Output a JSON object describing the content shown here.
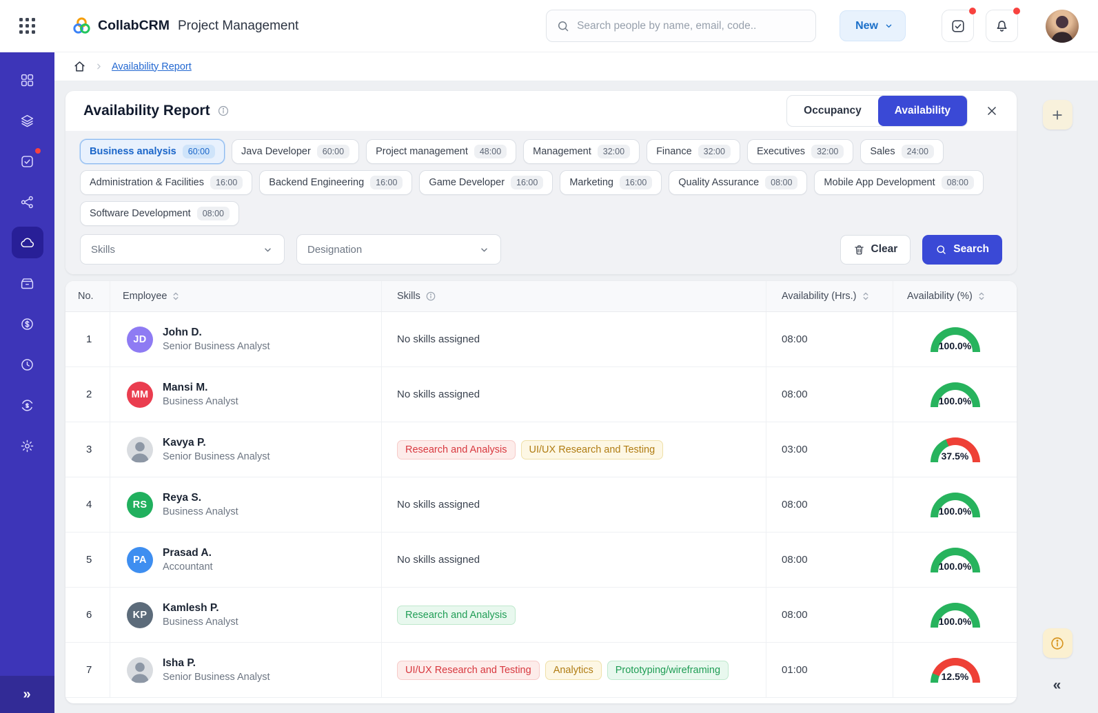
{
  "colors": {
    "sidebar": "#3d35b8",
    "accent_blue": "#3a49d6",
    "link_blue": "#2368d1",
    "chip_selected_blue": "#1b66c9",
    "gauge_green": "#27b35d",
    "gauge_red": "#ee4036",
    "notification_red": "#f8423f"
  },
  "header": {
    "brand": "CollabCRM",
    "product": "Project Management",
    "search_placeholder": "Search people by name, email, code..",
    "new_label": "New"
  },
  "sidebar": {
    "items": [
      {
        "icon": "dashboard",
        "active": false,
        "badge": false
      },
      {
        "icon": "layers",
        "active": false,
        "badge": false
      },
      {
        "icon": "tasks",
        "active": false,
        "badge": true
      },
      {
        "icon": "network",
        "active": false,
        "badge": false
      },
      {
        "icon": "cloud",
        "active": true,
        "badge": false
      },
      {
        "icon": "cashbox",
        "active": false,
        "badge": false
      },
      {
        "icon": "billing",
        "active": false,
        "badge": false
      },
      {
        "icon": "history",
        "active": false,
        "badge": false
      },
      {
        "icon": "exchange",
        "active": false,
        "badge": false
      },
      {
        "icon": "settings",
        "active": false,
        "badge": false
      }
    ],
    "expand_glyph": "»"
  },
  "breadcrumb": {
    "current": "Availability Report"
  },
  "report": {
    "title": "Availability Report",
    "toggles": {
      "occupancy": "Occupancy",
      "availability": "Availability"
    },
    "filters": [
      {
        "label": "Business analysis",
        "hours": "60:00",
        "selected": true
      },
      {
        "label": "Java Developer",
        "hours": "60:00",
        "selected": false
      },
      {
        "label": "Project management",
        "hours": "48:00",
        "selected": false
      },
      {
        "label": "Management",
        "hours": "32:00",
        "selected": false
      },
      {
        "label": "Finance",
        "hours": "32:00",
        "selected": false
      },
      {
        "label": "Executives",
        "hours": "32:00",
        "selected": false
      },
      {
        "label": "Sales",
        "hours": "24:00",
        "selected": false
      },
      {
        "label": "Administration & Facilities",
        "hours": "16:00",
        "selected": false
      },
      {
        "label": "Backend Engineering",
        "hours": "16:00",
        "selected": false
      },
      {
        "label": "Game Developer",
        "hours": "16:00",
        "selected": false
      },
      {
        "label": "Marketing",
        "hours": "16:00",
        "selected": false
      },
      {
        "label": "Quality Assurance",
        "hours": "08:00",
        "selected": false
      },
      {
        "label": "Mobile App Development",
        "hours": "08:00",
        "selected": false
      },
      {
        "label": "Software Development",
        "hours": "08:00",
        "selected": false
      }
    ],
    "skills_placeholder": "Skills",
    "designation_placeholder": "Designation",
    "clear_label": "Clear",
    "search_label": "Search"
  },
  "table": {
    "headers": {
      "no": "No.",
      "employee": "Employee",
      "skills": "Skills",
      "hours": "Availability (Hrs.)",
      "percent": "Availability (%)"
    },
    "empty_skills": "No skills assigned",
    "rows": [
      {
        "no": "1",
        "name": "John D.",
        "role": "Senior Business Analyst",
        "avatar": {
          "type": "initials",
          "text": "JD",
          "color": "#8e7bf3"
        },
        "skills": [],
        "hours": "08:00",
        "percent": 100,
        "percent_label": "100.0%"
      },
      {
        "no": "2",
        "name": "Mansi M.",
        "role": "Business Analyst",
        "avatar": {
          "type": "initials",
          "text": "MM",
          "color": "#ea3d4f"
        },
        "skills": [],
        "hours": "08:00",
        "percent": 100,
        "percent_label": "100.0%"
      },
      {
        "no": "3",
        "name": "Kavya P.",
        "role": "Senior Business Analyst",
        "avatar": {
          "type": "photo"
        },
        "skills": [
          {
            "label": "Research and Analysis",
            "variant": "red"
          },
          {
            "label": "UI/UX Research and Testing",
            "variant": "yellow"
          }
        ],
        "hours": "03:00",
        "percent": 37.5,
        "percent_label": "37.5%"
      },
      {
        "no": "4",
        "name": "Reya S.",
        "role": "Business Analyst",
        "avatar": {
          "type": "initials",
          "text": "RS",
          "color": "#21b05e"
        },
        "skills": [],
        "hours": "08:00",
        "percent": 100,
        "percent_label": "100.0%"
      },
      {
        "no": "5",
        "name": "Prasad A.",
        "role": "Accountant",
        "avatar": {
          "type": "initials",
          "text": "PA",
          "color": "#3e8ef0"
        },
        "skills": [],
        "hours": "08:00",
        "percent": 100,
        "percent_label": "100.0%"
      },
      {
        "no": "6",
        "name": "Kamlesh P.",
        "role": "Business Analyst",
        "avatar": {
          "type": "initials",
          "text": "KP",
          "color": "#5c6b7a"
        },
        "skills": [
          {
            "label": "Research and Analysis",
            "variant": "green"
          }
        ],
        "hours": "08:00",
        "percent": 100,
        "percent_label": "100.0%"
      },
      {
        "no": "7",
        "name": "Isha P.",
        "role": "Senior Business Analyst",
        "avatar": {
          "type": "photo"
        },
        "skills": [
          {
            "label": "UI/UX Research and Testing",
            "variant": "red"
          },
          {
            "label": "Analytics",
            "variant": "yellow"
          },
          {
            "label": "Prototyping/wireframing",
            "variant": "green"
          }
        ],
        "hours": "01:00",
        "percent": 12.5,
        "percent_label": "12.5%"
      }
    ]
  },
  "rail": {
    "collapse_glyph": "«"
  }
}
